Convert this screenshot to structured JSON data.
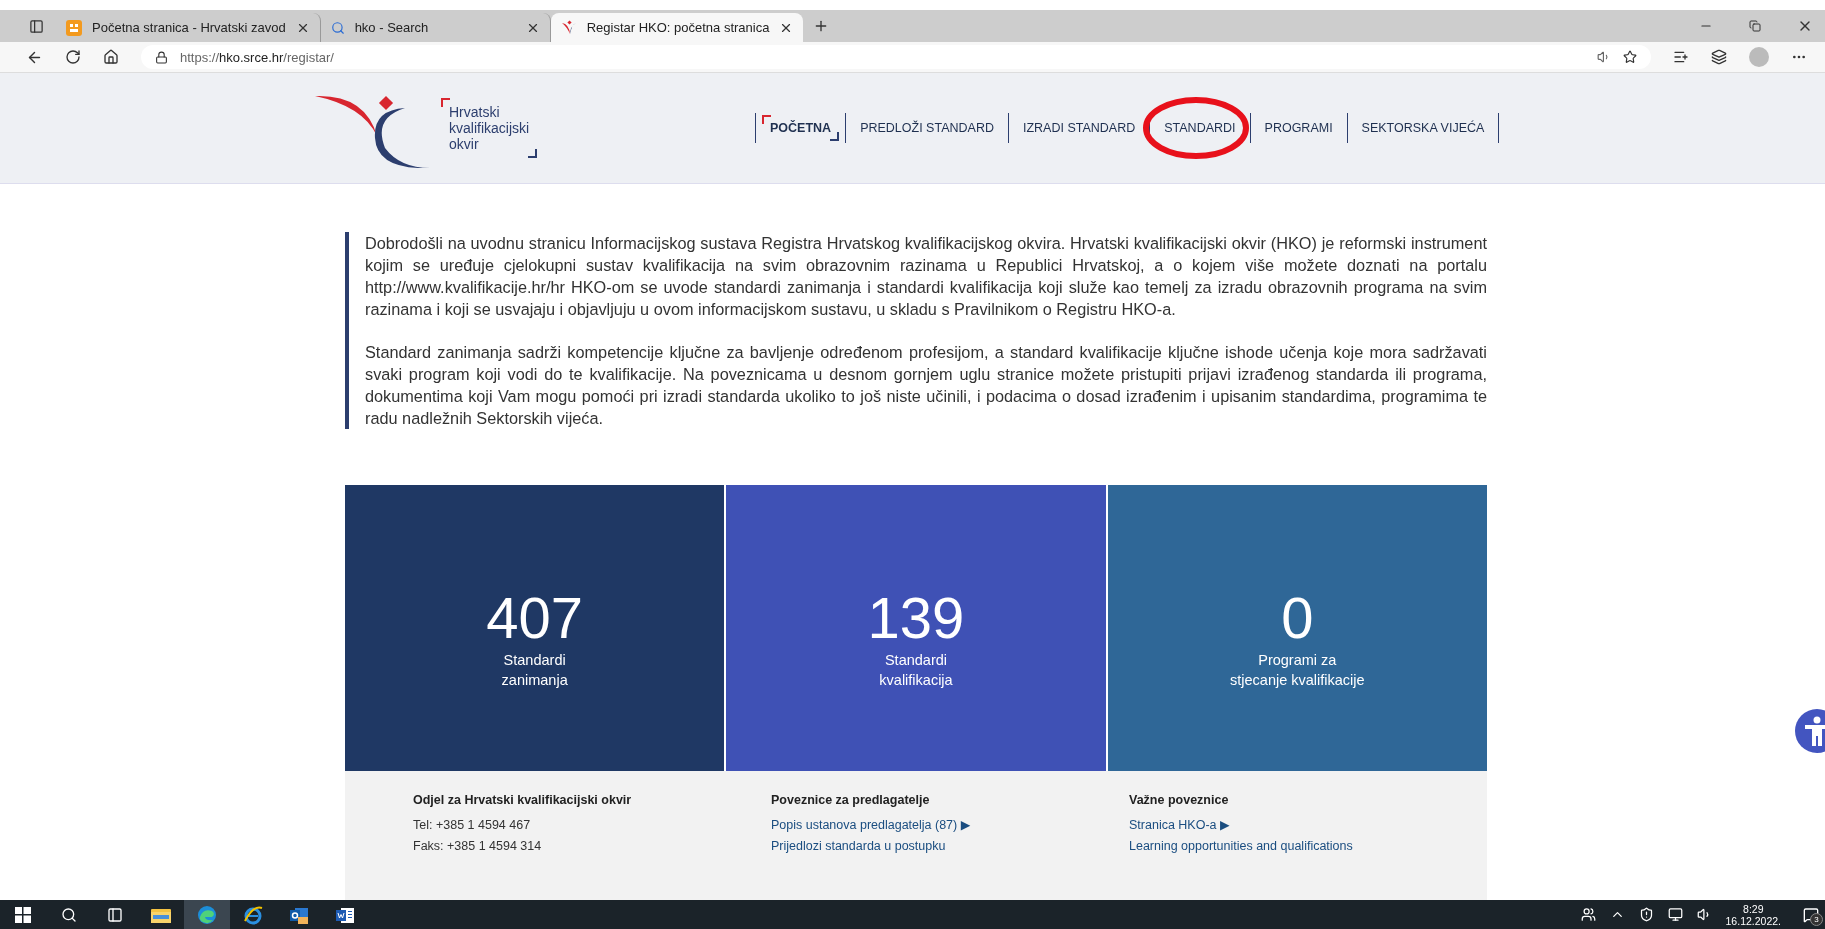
{
  "browser": {
    "tabs": [
      {
        "title": "Početna stranica - Hrvatski zavod",
        "kind": "orange",
        "selected": false
      },
      {
        "title": "hko - Search",
        "kind": "search",
        "selected": false
      },
      {
        "title": "Registar HKO: početna stranica",
        "kind": "hko",
        "selected": true
      }
    ],
    "url": {
      "scheme": "https://",
      "host": "hko.srce.hr",
      "path": "/registar/"
    }
  },
  "header": {
    "logo_lines": [
      "Hrvatski",
      "kvalifikacijski",
      "okvir"
    ],
    "nav": [
      {
        "label": "POČETNA",
        "selected": true
      },
      {
        "label": "PREDLOŽI STANDARD",
        "selected": false
      },
      {
        "label": "IZRADI STANDARD",
        "selected": false
      },
      {
        "label": "STANDARDI",
        "selected": false,
        "circled": true
      },
      {
        "label": "PROGRAMI",
        "selected": false
      },
      {
        "label": "SEKTORSKA VIJEĆA",
        "selected": false
      }
    ]
  },
  "intro": [
    "Dobrodošli na uvodnu stranicu Informacijskog sustava Registra Hrvatskog kvalifikacijskog okvira. Hrvatski kvalifikacijski okvir (HKO) je reformski instrument kojim se uređuje cjelokupni sustav kvalifikacija na svim obrazovnim razinama u Republici Hrvatskoj, a o kojem više možete doznati na portalu http://www.kvalifikacije.hr/hr HKO-om se uvode standardi zanimanja i standardi kvalifikacija koji služe kao temelj za izradu obrazovnih programa na svim razinama i koji se usvajaju i objavljuju u ovom informacijskom sustavu, u skladu s Pravilnikom o Registru HKO-a.",
    "Standard zanimanja sadrži kompetencije ključne za bavljenje određenom profesijom, a standard kvalifikacije ključne ishode učenja koje mora sadržavati svaki program koji vodi do te kvalifikacije. Na poveznicama u desnom gornjem uglu stranice možete pristupiti prijavi izrađenog standarda ili programa, dokumentima koji Vam mogu pomoći pri izradi standarda ukoliko to još niste učinili, i podacima o dosad izrađenim i upisanim standardima, programima te radu nadležnih Sektorskih vijeća."
  ],
  "stats": [
    {
      "value": "407",
      "label": "Standardi\nzanimanja",
      "color": "#1f3864"
    },
    {
      "value": "139",
      "label": "Standardi\nkvalifikacija",
      "color": "#3f51b5"
    },
    {
      "value": "0",
      "label": "Programi za\nstjecanje kvalifikacije",
      "color": "#2f6797"
    }
  ],
  "footer": [
    {
      "heading": "Odjel za Hrvatski kvalifikacijski okvir",
      "items": [
        {
          "text": "Tel: +385 1 4594 467",
          "kind": "text"
        },
        {
          "text": "Faks: +385 1 4594 314",
          "kind": "text"
        }
      ]
    },
    {
      "heading": "Poveznice za predlagatelje",
      "items": [
        {
          "text": "Popis ustanova predlagatelja (87) ▶",
          "kind": "link"
        },
        {
          "text": "Prijedlozi standarda u postupku",
          "kind": "link"
        }
      ]
    },
    {
      "heading": "Važne poveznice",
      "items": [
        {
          "text": "Stranica HKO-a ▶",
          "kind": "link"
        },
        {
          "text": "Learning opportunities and qualifications",
          "kind": "link"
        }
      ]
    }
  ],
  "taskbar": {
    "apps": [
      {
        "kind": "folder",
        "selected": false
      },
      {
        "kind": "edge",
        "selected": true
      },
      {
        "kind": "ie",
        "selected": false
      },
      {
        "kind": "outlook",
        "selected": false
      },
      {
        "kind": "word",
        "selected": false
      }
    ],
    "time": "8:29",
    "date": "16.12.2022.",
    "notifications": "3"
  }
}
